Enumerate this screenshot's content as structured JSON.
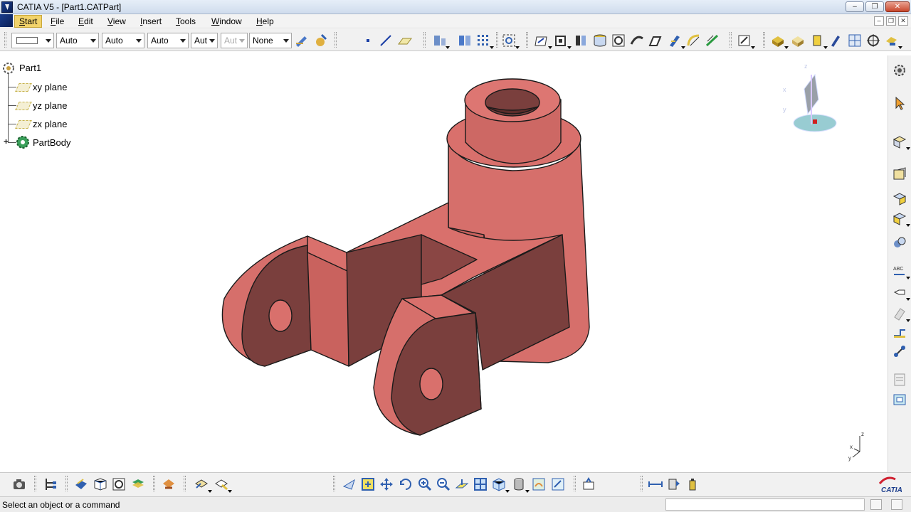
{
  "window": {
    "title": "CATIA V5 - [Part1.CATPart]",
    "controls": {
      "minimize": "–",
      "restore": "❐",
      "close": "✕"
    }
  },
  "menubar": {
    "items": [
      "Start",
      "File",
      "Edit",
      "View",
      "Insert",
      "Tools",
      "Window",
      "Help"
    ],
    "doc_controls": {
      "minimize": "–",
      "restore": "❐",
      "close": "✕"
    }
  },
  "graphic_properties": {
    "color_value": "",
    "transparency": "Auto",
    "line_thickness": "Auto",
    "line_type": "Auto",
    "point_type": "Aut",
    "layer_disabled": "Aut",
    "render_style": "None"
  },
  "tree": {
    "root": "Part1",
    "items": [
      {
        "label": "xy plane",
        "icon": "plane-icon"
      },
      {
        "label": "yz plane",
        "icon": "plane-icon"
      },
      {
        "label": "zx plane",
        "icon": "plane-icon"
      },
      {
        "label": "PartBody",
        "icon": "partbody-gear-icon"
      }
    ]
  },
  "compass_axes": {
    "z": "z",
    "x": "x",
    "y": "y"
  },
  "axis_triad": {
    "z": "z",
    "x": "x",
    "y": "y"
  },
  "status": {
    "message": "Select an object or a command"
  },
  "brand": {
    "logo_text": "CATIA"
  },
  "colors": {
    "part_face": "#d9706c",
    "part_shadow": "#7a3f3d",
    "menu_start_highlight": "#f2d36b"
  }
}
